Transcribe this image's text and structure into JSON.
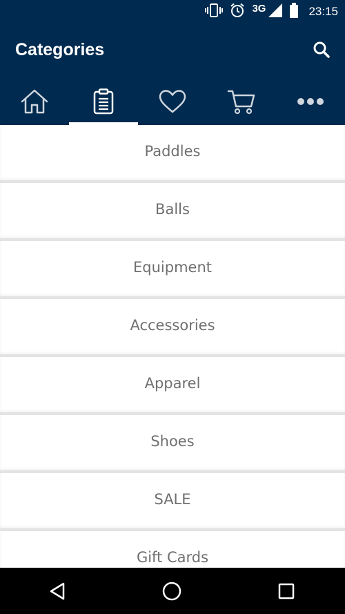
{
  "status_bar": {
    "network": "3G",
    "time": "23:15",
    "icons": [
      "vibrate-icon",
      "alarm-icon",
      "signal-icon",
      "battery-icon"
    ]
  },
  "app_bar": {
    "title": "Categories",
    "search_icon": "search-icon"
  },
  "tabs": [
    {
      "icon": "home-icon",
      "active": false
    },
    {
      "icon": "clipboard-icon",
      "active": true
    },
    {
      "icon": "heart-icon",
      "active": false
    },
    {
      "icon": "cart-icon",
      "active": false
    },
    {
      "icon": "more-icon",
      "active": false
    }
  ],
  "categories": [
    "Paddles",
    "Balls",
    "Equipment",
    "Accessories",
    "Apparel",
    "Shoes",
    "SALE",
    "Gift Cards"
  ],
  "nav_bar": {
    "icons": [
      "back-icon",
      "home-circle-icon",
      "recents-icon"
    ]
  },
  "colors": {
    "header_bg": "#002a4f",
    "tab_icon": "#cfd6de",
    "item_text": "#6f6f6f",
    "divider": "#e3e3e3"
  }
}
